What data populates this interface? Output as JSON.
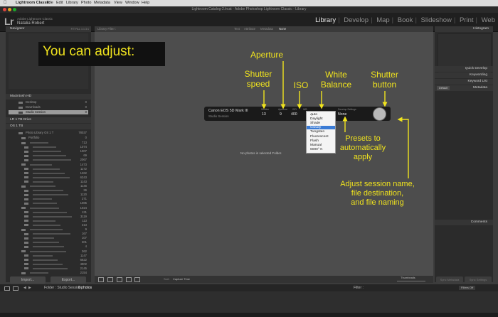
{
  "menubar": {
    "app_name": "Lightroom Classic",
    "items": [
      "File",
      "Edit",
      "Library",
      "Photo",
      "Metadata",
      "View",
      "Window",
      "Help"
    ]
  },
  "window": {
    "title": "Lightroom Catalog-2.lrcat - Adobe Photoshop Lightroom Classic - Library"
  },
  "identity": {
    "logo": "Lr",
    "product": "Adobe Lightroom Classic",
    "user": "Natalia Robert"
  },
  "modules": {
    "items": [
      "Library",
      "Develop",
      "Map",
      "Book",
      "Slideshow",
      "Print",
      "Web"
    ],
    "separator": "|",
    "active": "Library"
  },
  "left_panel": {
    "navigator": {
      "title": "Navigator",
      "zoom_options": "FIT  FILL  1:1  3:1"
    },
    "volume1": {
      "label": "Macintosh HD",
      "stats": ""
    },
    "folders_a": [
      {
        "name": "Desktop",
        "count": "0"
      },
      {
        "name": "Downloads",
        "count": "0"
      },
      {
        "name": "Studio Session",
        "count": "0",
        "selected": true
      }
    ],
    "volume2": {
      "label": "LR 1 TB Drive",
      "stats": ""
    },
    "volume3": {
      "label": "OS 1 TB",
      "stats": ""
    },
    "photo_library": {
      "name": "Photo Library OS 1 T",
      "count": "78037"
    },
    "portfolio": {
      "name": "Portfolio",
      "count": "0"
    },
    "folder_counts": [
      "713",
      "1074",
      "1007",
      "69",
      "2067",
      "1473",
      "1172",
      "1262",
      "6343",
      "1143",
      "1146",
      "36",
      "1120",
      "271",
      "1085",
      "1024",
      "131",
      "3119",
      "113",
      "313",
      "9",
      "167",
      "107",
      "301",
      "4",
      "362",
      "1147",
      "6622",
      "4902",
      "2145",
      "2154"
    ],
    "import_label": "Import...",
    "export_label": "Export..."
  },
  "right_panel": {
    "histogram_title": "Histogram",
    "quick_develop": "Quick Develop",
    "keywording": "Keywording",
    "keyword_list": "Keyword List",
    "metadata": "Metadata",
    "metadata_preset": "Default",
    "comments": "Comments",
    "sync_metadata": "Sync Metadata",
    "sync_settings": "Sync Settings"
  },
  "main": {
    "filter_title": "Library Filter :",
    "filter_tabs": [
      "Text",
      "Attribute",
      "Metadata",
      "None"
    ],
    "empty_message": "No photos in selected Folder."
  },
  "tether": {
    "camera": "Canon EOS 5D Mark III",
    "session": "Studio Session",
    "shutter_label": "Shutter",
    "shutter_value": "13",
    "aperture_label": "Aperture",
    "aperture_value": "9",
    "iso_label": "ISO",
    "iso_value": "400",
    "wb_label": "WB",
    "develop_label": "Develop Settings",
    "develop_value": "None"
  },
  "wb_dropdown": {
    "options": [
      "Auto",
      "Daylight",
      "Shade",
      "Cloudy",
      "Tungsten",
      "Fluorescent",
      "Flash",
      "Manual",
      "6000° K"
    ],
    "checked": "Auto",
    "highlighted": "Cloudy"
  },
  "annotations": {
    "adjust": "You can adjust:",
    "aperture": "Aperture",
    "shutter_speed": "Shutter\nspeed",
    "iso": "ISO",
    "white_balance": "White\nBalance",
    "shutter_button": "Shutter\nbutton",
    "presets": "Presets to\nautomatically\napply",
    "session": "Adjust session name,\nfile destination,\nand file naming",
    "color": "#f0e31e"
  },
  "toolbar": {
    "sort_label": "Sort:",
    "sort_value": "Capture Time",
    "thumbnails_label": "Thumbnails"
  },
  "bottom_bar": {
    "path": "Folder : Studio Session",
    "photo_count": "0 photos",
    "filter_label": "Filter :",
    "filter_value": "Filters Off"
  }
}
